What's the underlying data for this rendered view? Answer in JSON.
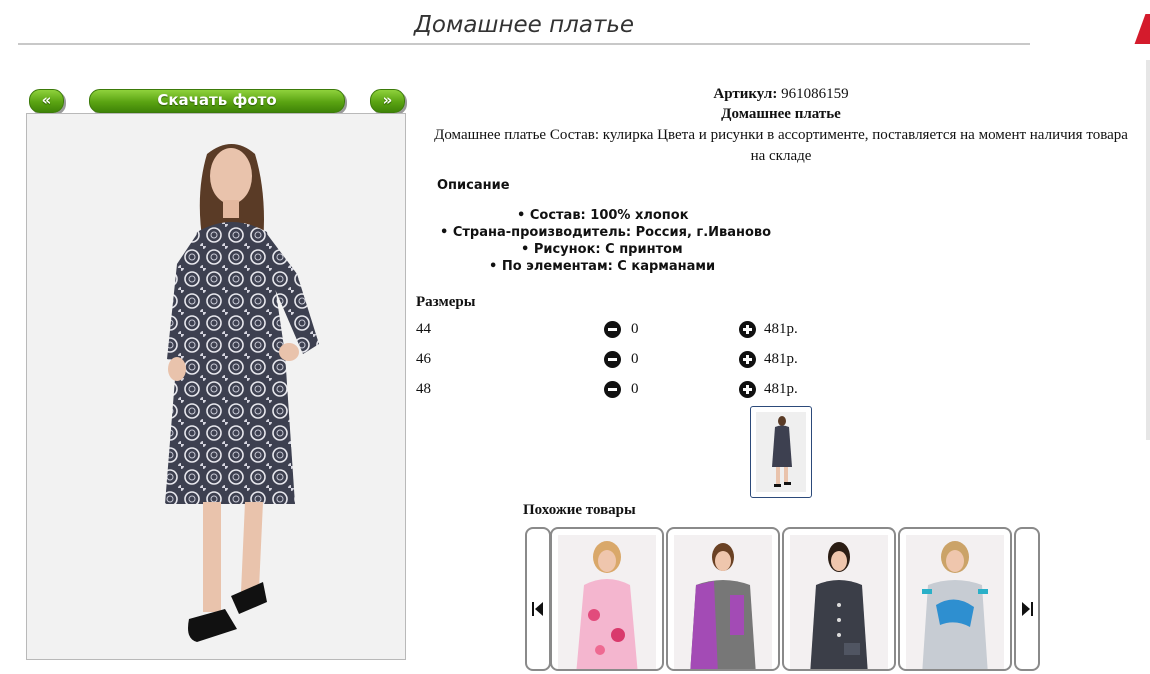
{
  "header": {
    "title": "Домашнее платье"
  },
  "gallery": {
    "prev_label": "«",
    "download_label": "Скачать фото",
    "next_label": "»"
  },
  "product": {
    "article_label": "Артикул:",
    "article_value": "961086159",
    "name": "Домашнее платье",
    "description": "Домашнее платье Состав: кулирка Цвета и рисунки в ассортименте, поставляется на момент наличия товара на складе"
  },
  "specs": {
    "heading": "Описание",
    "items": [
      "Состав: 100% хлопок",
      "Страна-производитель: Россия, г.Иваново",
      "Рисунок: С принтом",
      "По элементам: С карманами"
    ]
  },
  "sizes": {
    "heading": "Размеры",
    "rows": [
      {
        "size": "44",
        "qty": "0",
        "price": "481р."
      },
      {
        "size": "46",
        "qty": "0",
        "price": "481р."
      },
      {
        "size": "48",
        "qty": "0",
        "price": "481р."
      }
    ]
  },
  "similar": {
    "heading": "Похожие товары",
    "items": [
      "pink-floral-robe",
      "grey-purple-dress",
      "dark-dotted-dress",
      "grey-blue-print-dress"
    ]
  },
  "icons": {
    "minus": "minus-circle-icon",
    "plus": "plus-circle-icon",
    "carousel_prev": "skip-previous-icon",
    "carousel_next": "skip-next-icon"
  },
  "colors": {
    "accent_green": "#5aa312",
    "title_rule": "#c8c8c8",
    "brand_red": "#d41b2c",
    "thumb_border": "#2c4a7a"
  }
}
